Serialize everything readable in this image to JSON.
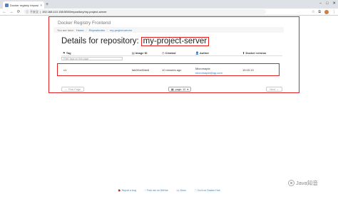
{
  "browser": {
    "tab_title": "Docker registry /repository/m",
    "tab_close": "×",
    "new_tab": "+",
    "window_controls": [
      "–",
      "□",
      "✕"
    ],
    "nav": {
      "back": "←",
      "forward": "→",
      "reload": "⟳"
    },
    "security_label": "不安全",
    "url": "192.168.110.158:5050/repository/my-project-server",
    "toolbar_icons": [
      "star-icon",
      "extensions-icon",
      "profile-avatar",
      "menu-icon"
    ]
  },
  "app": {
    "brand": "Docker Registry Frontend",
    "breadcrumb": {
      "prefix": "You are here:",
      "items": [
        "Home",
        "Repositories",
        "my-project-server"
      ]
    },
    "heading_prefix": "Details for repository:",
    "heading_repo": "my-project-server",
    "table": {
      "headers": [
        "Tag",
        "Image ID",
        "Created",
        "Author",
        "Docker version"
      ],
      "filter_placeholder": "Filter tags on this page",
      "rows": [
        {
          "tag": "v1",
          "image_id": "fab0f1e80dc6",
          "created": "10 minutes ago",
          "author": "Micromaple",
          "author_email": "micromaple@qq.com",
          "docker_version": "19.03.13"
        }
      ]
    },
    "pager": {
      "first": "← First Page",
      "page_size_label": "page: 10",
      "next": "Next →"
    }
  },
  "footer": {
    "links": [
      "Report a bug",
      "Fork me on GitHub",
      "Docs",
      "Do it on Docker Hub"
    ]
  },
  "watermark": {
    "text": "Java知音"
  },
  "colors": {
    "highlight": "#e02222",
    "link": "#337ab7"
  }
}
